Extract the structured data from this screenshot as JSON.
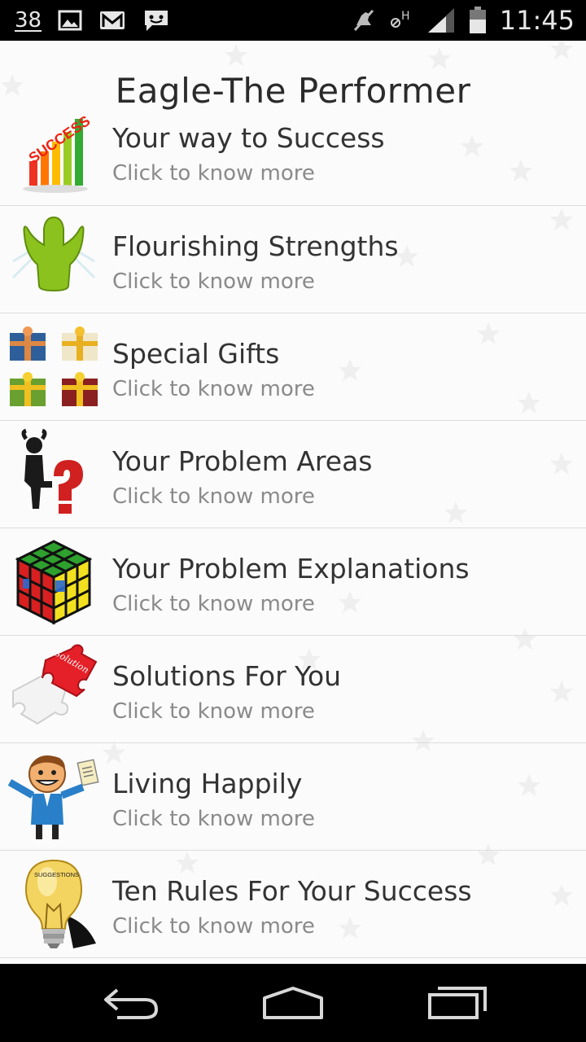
{
  "status_bar": {
    "notification_count": "38",
    "time": "11:45",
    "network_label": "H",
    "icons": [
      "gallery-icon",
      "gmail-icon",
      "messaging-icon",
      "mute-icon",
      "network-h-icon",
      "signal-icon",
      "battery-icon"
    ]
  },
  "header": {
    "title": "Eagle-The Performer"
  },
  "list": {
    "items": [
      {
        "title": "Your way to Success",
        "subtitle": "Click to know more",
        "icon": "success-chart-icon"
      },
      {
        "title": "Flourishing Strengths",
        "subtitle": "Click to know more",
        "icon": "strength-figure-icon"
      },
      {
        "title": "Special Gifts",
        "subtitle": "Click to know more",
        "icon": "gift-boxes-icon"
      },
      {
        "title": "Your Problem Areas",
        "subtitle": "Click to know more",
        "icon": "question-figure-icon"
      },
      {
        "title": "Your Problem Explanations",
        "subtitle": "Click to know more",
        "icon": "rubiks-cube-icon"
      },
      {
        "title": "Solutions For You",
        "subtitle": "Click to know more",
        "icon": "puzzle-solution-icon"
      },
      {
        "title": "Living Happily",
        "subtitle": "Click to know more",
        "icon": "happy-man-icon"
      },
      {
        "title": "Ten Rules For Your Success",
        "subtitle": "Click to know more",
        "icon": "suggestions-bulb-icon"
      }
    ]
  },
  "navigation": {
    "buttons": [
      "back-icon",
      "home-icon",
      "recent-apps-icon"
    ]
  }
}
